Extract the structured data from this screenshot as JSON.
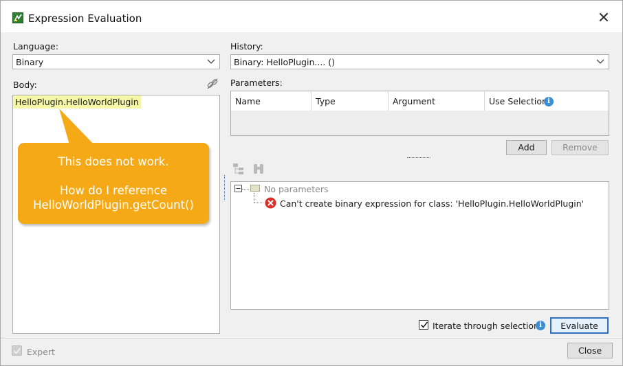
{
  "window": {
    "title": "Expression Evaluation"
  },
  "left": {
    "language_label": "Language:",
    "language_value": "Binary",
    "body_label": "Body:",
    "body_text": "HelloPlugin.HelloWorldPlugin",
    "callout_line1": "This does not work.",
    "callout_line2": "How do I reference",
    "callout_line3": "HelloWorldPlugin.getCount()"
  },
  "right": {
    "history_label": "History:",
    "history_value": "Binary: HelloPlugin.... ()",
    "parameters_label": "Parameters:",
    "columns": [
      "Name",
      "Type",
      "Argument",
      "Use Selection"
    ],
    "add_label": "Add",
    "remove_label": "Remove",
    "tree_root": "No parameters",
    "tree_error": "Can't create binary expression for class: 'HelloPlugin.HelloWorldPlugin'",
    "iterate_label": "Iterate through selection",
    "iterate_checked": true,
    "evaluate_label": "Evaluate"
  },
  "footer": {
    "expert_label": "Expert",
    "close_label": "Close"
  },
  "colors": {
    "callout": "#f5a916",
    "highlight": "#f5f7a6",
    "info": "#3b8fd6",
    "error": "#d9302c"
  }
}
